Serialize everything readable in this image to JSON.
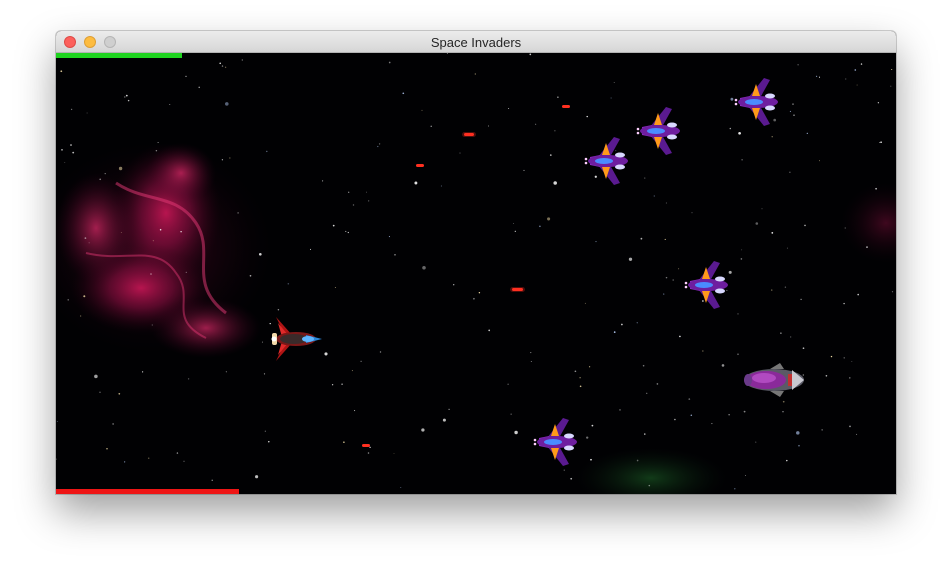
{
  "window": {
    "title": "Space Invaders"
  },
  "game": {
    "top_bar": {
      "fraction": 0.15,
      "color": "#1fd31f"
    },
    "bottom_bar": {
      "fraction": 0.218,
      "color": "#ee1515"
    },
    "colors": {
      "background": "#010103",
      "nebula": "#d2185a",
      "player": "#d61c1c",
      "enemy": "#6e1ea0",
      "laser": "#ff3020"
    },
    "sprites": {
      "player": "red-fighter-ship",
      "enemies": "purple-fighter-ships",
      "bomber": "grey-purple-bomber-ship",
      "projectiles": "red-laser-bolts"
    }
  }
}
